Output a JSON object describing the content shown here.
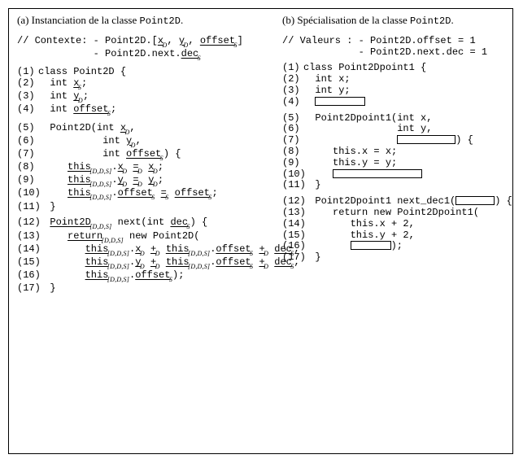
{
  "left": {
    "title_a": "(a) Instanciation de la classe ",
    "title_b": "Point2D",
    "title_c": ".",
    "ctx1": "// Contexte: - Point2D.[",
    "ctx_x": "x",
    "ctx_sep1": ", ",
    "ctx_y": "y",
    "ctx_sep2": ", ",
    "ctx_off": "offset",
    "ctx_close": "]",
    "ctx2a": "             - Point2D.next.",
    "ctx2b": "dec",
    "ln1": "class Point2D {",
    "ln2a": "  int ",
    "ln2b": "x",
    "ln2c": ";",
    "ln3a": "  int ",
    "ln3b": "y",
    "ln3c": ";",
    "ln4a": "  int ",
    "ln4b": "offset",
    "ln4c": ";",
    "ln5a": "  Point2D(int ",
    "ln5b": "x",
    "ln5c": ",",
    "ln6a": "           int ",
    "ln6b": "y",
    "ln6c": ",",
    "ln7a": "           int ",
    "ln7b": "offset",
    "ln7c": ") {",
    "ln8a": "     ",
    "ln8b": "this",
    "ln8c": ".",
    "ln8d": "x",
    "ln8e": " ",
    "ln8f": "=",
    "ln8g": " ",
    "ln8h": "x",
    "ln8i": ";",
    "ln9a": "     ",
    "ln9b": "this",
    "ln9c": ".",
    "ln9d": "y",
    "ln9e": " ",
    "ln9f": "=",
    "ln9g": " ",
    "ln9h": "y",
    "ln9i": ";",
    "ln10a": "     ",
    "ln10b": "this",
    "ln10c": ".",
    "ln10d": "offset",
    "ln10e": " ",
    "ln10f": "=",
    "ln10g": " ",
    "ln10h": "offset",
    "ln10i": ";",
    "ln11": "  }",
    "ln12a": "  ",
    "ln12b": "Point2D",
    "ln12c": " next(int ",
    "ln12d": "dec",
    "ln12e": ") {",
    "ln13a": "     ",
    "ln13b": "return",
    "ln13c": " new Point2D(",
    "ln14a": "        ",
    "ln14b": "this",
    "ln14c": ".",
    "ln14d": "x",
    "ln14e": " ",
    "ln14f": "+",
    "ln14g": " ",
    "ln14h": "this",
    "ln14i": ".",
    "ln14j": "offset",
    "ln14k": " ",
    "ln14l": "+",
    "ln14m": " ",
    "ln14n": "dec",
    "ln14o": ",",
    "ln15a": "        ",
    "ln15b": "this",
    "ln15c": ".",
    "ln15d": "y",
    "ln15e": " ",
    "ln15f": "+",
    "ln15g": " ",
    "ln15h": "this",
    "ln15i": ".",
    "ln15j": "offset",
    "ln15k": " ",
    "ln15l": "+",
    "ln15m": " ",
    "ln15n": "dec",
    "ln15o": ",",
    "ln16a": "        ",
    "ln16b": "this",
    "ln16c": ".",
    "ln16d": "offset",
    "ln16e": ");",
    "ln17": "  }",
    "subD": "D",
    "subS": "S",
    "subDDS": "[D,D,S]"
  },
  "right": {
    "title_a": "(b) Spécialisation de la classe ",
    "title_b": "Point2D",
    "title_c": ".",
    "val1": "// Valeurs : - Point2D.offset = 1",
    "val2": "             - Point2D.next.dec = 1",
    "ln1": "class Point2Dpoint1 {",
    "ln2": "  int x;",
    "ln3": "  int y;",
    "ln5": "  Point2Dpoint1(int x,",
    "ln6": "                int y,",
    "ln7a": "                ",
    "ln7b": ") {",
    "ln8": "     this.x = x;",
    "ln9": "     this.y = y;",
    "ln11": "  }",
    "ln12a": "  Point2Dpoint1 next_dec1(",
    "ln12b": ") {",
    "ln13": "     return new Point2Dpoint1(",
    "ln14": "        this.x + 2,",
    "ln15": "        this.y + 2,",
    "ln16a": "        ",
    "ln16b": ");",
    "ln17": "  }",
    "n1": "(1)",
    "n2": "(2)",
    "n3": "(3)",
    "n4": "(4)",
    "n5": "(5)",
    "n6": "(6)",
    "n7": "(7)",
    "n8": "(8)",
    "n9": "(9)",
    "n10": "(10)",
    "n11": "(11)",
    "n12": "(12)",
    "n13": "(13)",
    "n14": "(14)",
    "n15": "(15)",
    "n16": "(16)",
    "n17": "(17)"
  }
}
